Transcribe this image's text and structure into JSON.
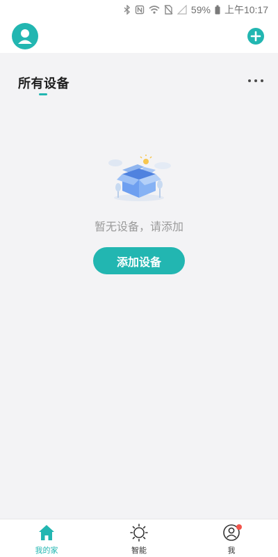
{
  "status_bar": {
    "battery": "59%",
    "time": "上午10:17",
    "icons": [
      "bluetooth-icon",
      "nfc-icon",
      "wifi-icon",
      "no-sim-icon",
      "signal-icon",
      "battery-icon"
    ]
  },
  "header": {
    "icons": [
      "avatar-icon",
      "add-icon"
    ]
  },
  "section": {
    "title": "所有设备",
    "more_icon": "more-icon"
  },
  "empty_state": {
    "message": "暂无设备，请添加",
    "button_label": "添加设备",
    "illustration": "empty-box-icon"
  },
  "bottom_nav": {
    "items": [
      {
        "label": "我的家",
        "icon": "home-icon",
        "active": true
      },
      {
        "label": "智能",
        "icon": "sun-icon",
        "active": false
      },
      {
        "label": "我",
        "icon": "profile-icon",
        "active": false,
        "badge": true
      }
    ]
  },
  "colors": {
    "accent": "#22b6b1",
    "background": "#f3f3f5",
    "badge": "#f2544b"
  }
}
